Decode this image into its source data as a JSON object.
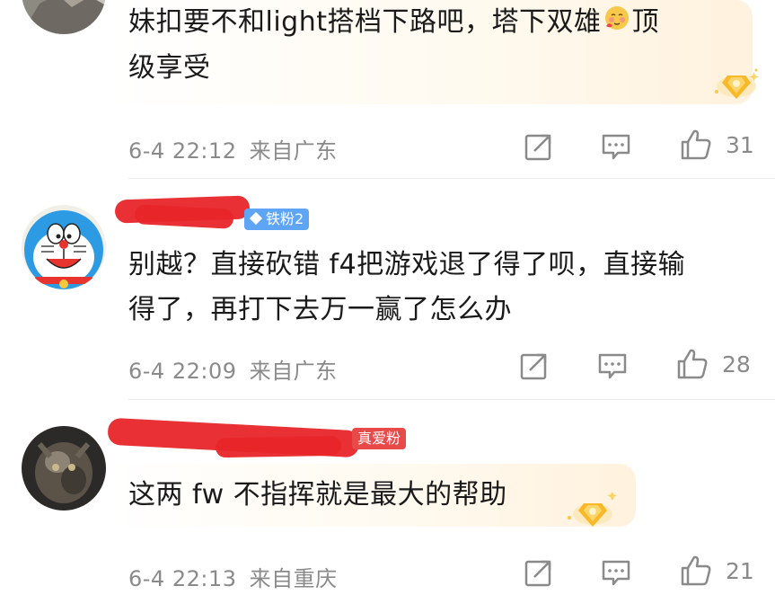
{
  "comments": [
    {
      "text_line1": "妹扣要不和light搭档下路吧，塔下双雄",
      "text_line2": "顶",
      "text_line3": "级享受",
      "emoji": "shy-face-emoji",
      "date": "6-4 22:12",
      "location": "来自广东",
      "likes": "31"
    },
    {
      "badge": "铁粉2",
      "text_line1": "别越？直接砍错 f4把游戏退了得了呗，直接输",
      "text_line2": "得了，再打下去万一赢了怎么办",
      "date": "6-4 22:09",
      "location": "来自广东",
      "likes": "28"
    },
    {
      "badge": "真爱粉",
      "text_line1": "这两 fw 不指挥就是最大的帮助",
      "date": "6-4 22:13",
      "location": "来自重庆",
      "likes": "21"
    }
  ],
  "icons": {
    "share": "share-icon",
    "comment": "comment-icon",
    "like": "thumbs-up-icon",
    "medal": "gold-medal-icon"
  },
  "colors": {
    "text": "#1a1a1a",
    "meta": "#8a8a8a",
    "badge_blue": "#5fa5f6",
    "badge_red": "#e84a4a",
    "redaction": "#e8262a"
  }
}
